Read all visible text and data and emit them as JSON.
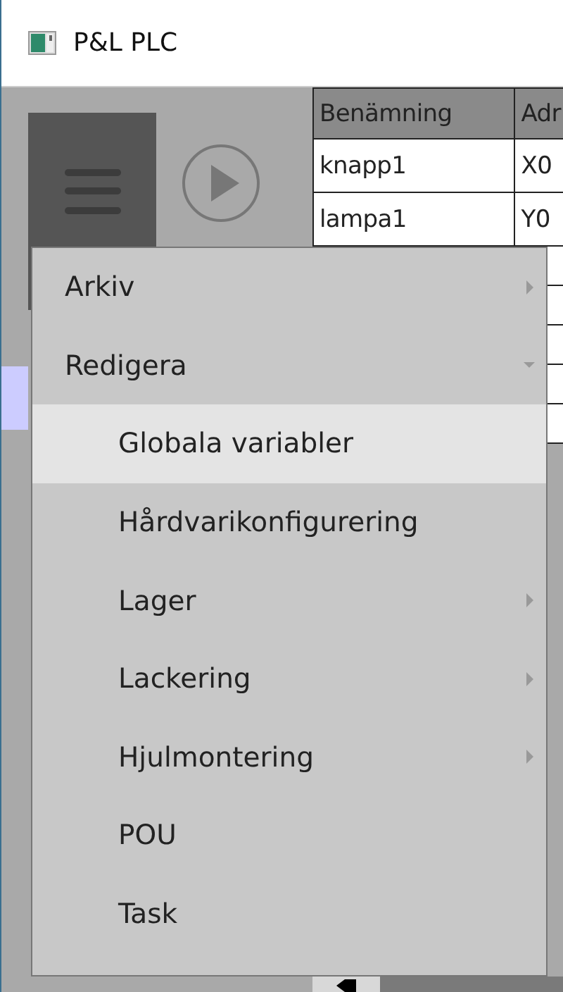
{
  "window": {
    "title": "P&L PLC"
  },
  "table": {
    "columns": [
      "Benämning",
      "Adr"
    ],
    "rows": [
      [
        "knapp1",
        "X0"
      ],
      [
        "lampa1",
        "Y0"
      ]
    ]
  },
  "menu": {
    "items": [
      {
        "label": "Arkiv",
        "kind": "submenu",
        "selected": false
      },
      {
        "label": "Redigera",
        "kind": "group",
        "expanded": true,
        "selected": false,
        "children": [
          {
            "label": "Globala variabler",
            "kind": "action",
            "selected": true
          },
          {
            "label": "Hårdvarikonfigurering",
            "kind": "action",
            "selected": false
          },
          {
            "label": "Lager",
            "kind": "submenu",
            "selected": false
          },
          {
            "label": "Lackering",
            "kind": "submenu",
            "selected": false
          },
          {
            "label": "Hjulmontering",
            "kind": "submenu",
            "selected": false
          },
          {
            "label": "POU",
            "kind": "action",
            "selected": false
          },
          {
            "label": "Task",
            "kind": "action",
            "selected": false
          }
        ]
      }
    ]
  }
}
